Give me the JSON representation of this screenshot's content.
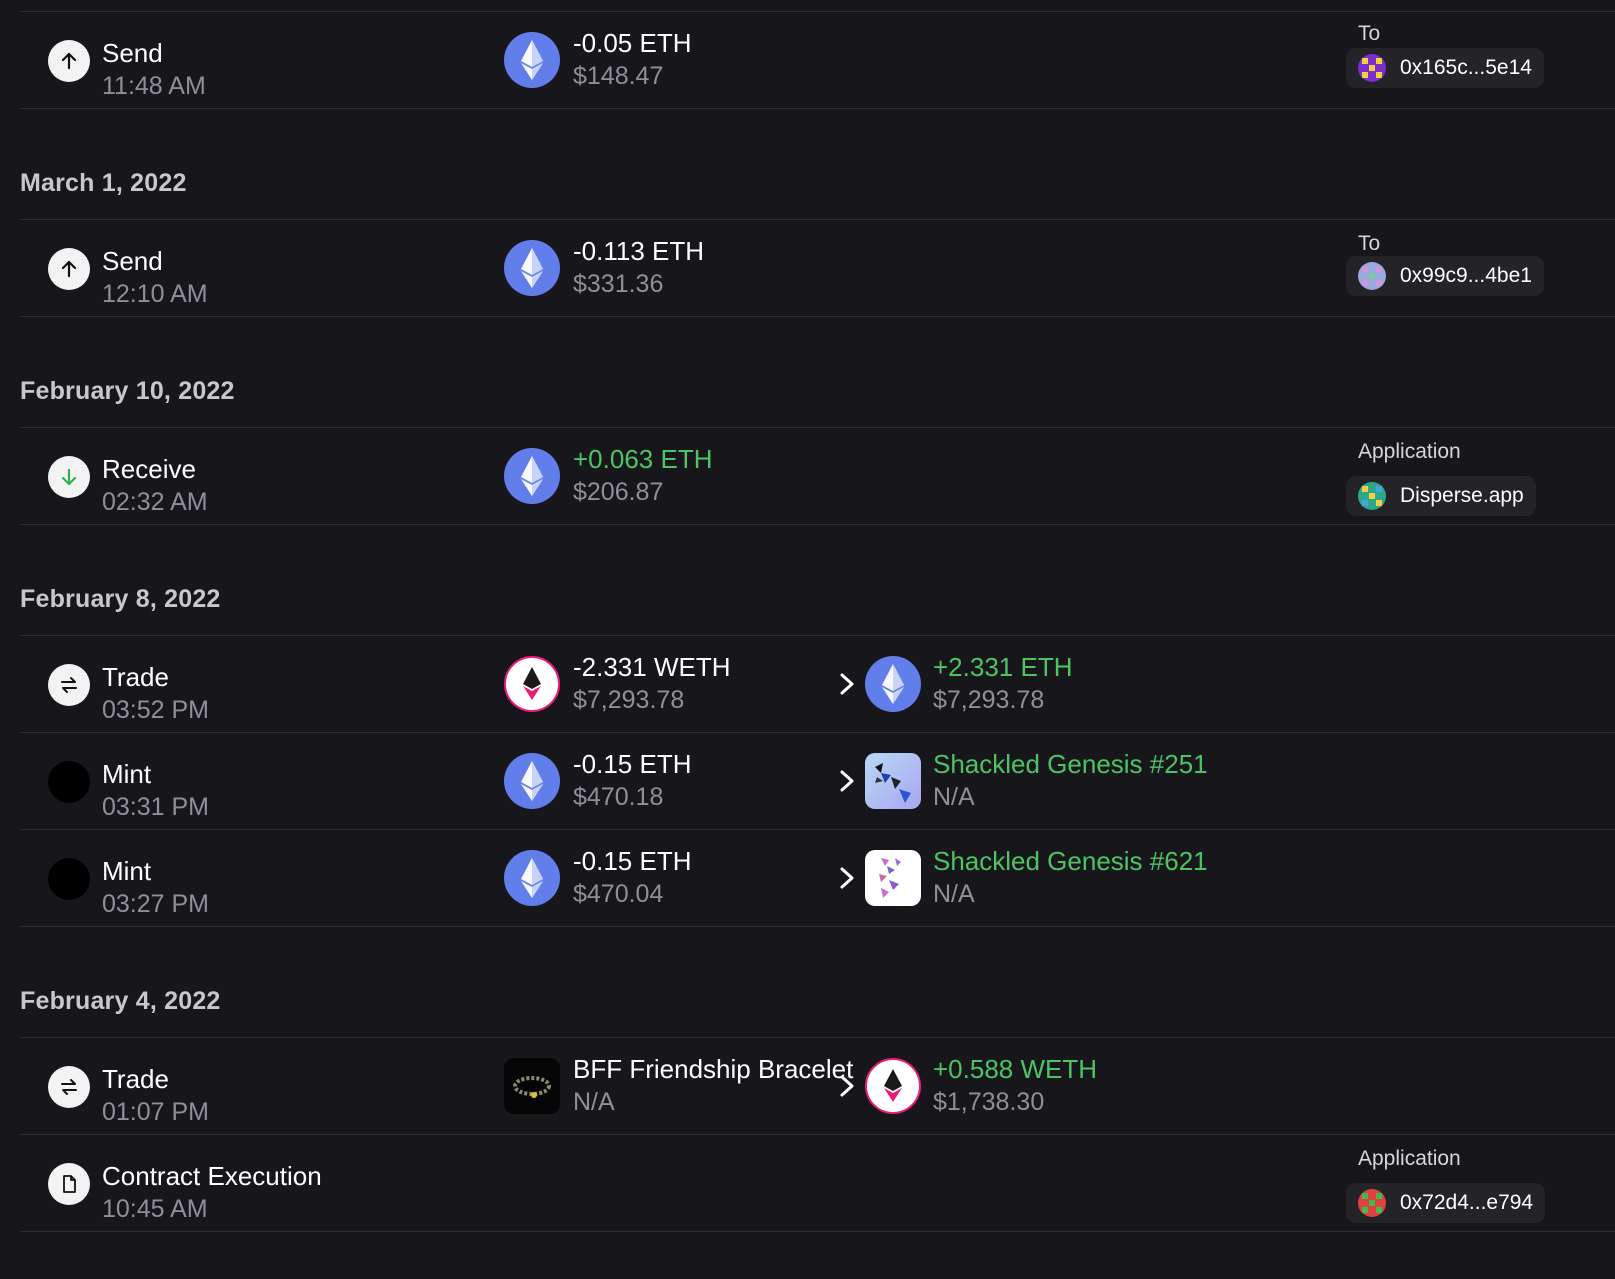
{
  "colors": {
    "background": "#17171b",
    "positive": "#4cc463",
    "muted": "#8f8f98",
    "eth": "#627eea",
    "weth": "#ec1c79"
  },
  "top_group": {
    "rows": [
      {
        "type": "Send",
        "time": "11:48 AM",
        "icon": "arrow-up-icon",
        "from_amount": "-0.05 ETH",
        "from_value": "$148.47",
        "counterparty_label": "To",
        "counterparty": "0x165c...5e14"
      }
    ]
  },
  "group_mar1": {
    "date": "March 1, 2022",
    "rows": [
      {
        "type": "Send",
        "time": "12:10 AM",
        "icon": "arrow-up-icon",
        "from_amount": "-0.113 ETH",
        "from_value": "$331.36",
        "counterparty_label": "To",
        "counterparty": "0x99c9...4be1"
      }
    ]
  },
  "group_feb10": {
    "date": "February 10, 2022",
    "rows": [
      {
        "type": "Receive",
        "time": "02:32 AM",
        "icon": "arrow-down-icon",
        "from_amount": "+0.063 ETH",
        "from_value": "$206.87",
        "counterparty_label": "Application",
        "counterparty": "Disperse.app"
      }
    ]
  },
  "group_feb8": {
    "date": "February 8, 2022",
    "rows": [
      {
        "type": "Trade",
        "time": "03:52 PM",
        "icon": "swap-icon",
        "from_amount": "-2.331 WETH",
        "from_value": "$7,293.78",
        "to_amount": "+2.331 ETH",
        "to_value": "$7,293.78"
      },
      {
        "type": "Mint",
        "time": "03:31 PM",
        "icon": "black-dot-icon",
        "from_amount": "-0.15 ETH",
        "from_value": "$470.18",
        "to_amount": "Shackled Genesis #251",
        "to_value": "N/A"
      },
      {
        "type": "Mint",
        "time": "03:27 PM",
        "icon": "black-dot-icon",
        "from_amount": "-0.15 ETH",
        "from_value": "$470.04",
        "to_amount": "Shackled Genesis #621",
        "to_value": "N/A"
      }
    ]
  },
  "group_feb4": {
    "date": "February 4, 2022",
    "rows": [
      {
        "type": "Trade",
        "time": "01:07 PM",
        "icon": "swap-icon",
        "from_amount": "BFF Friendship Bracelet",
        "from_value": "N/A",
        "to_amount": "+0.588 WETH",
        "to_value": "$1,738.30"
      },
      {
        "type": "Contract Execution",
        "time": "10:45 AM",
        "icon": "document-icon",
        "counterparty_label": "Application",
        "counterparty": "0x72d4...e794"
      }
    ]
  }
}
